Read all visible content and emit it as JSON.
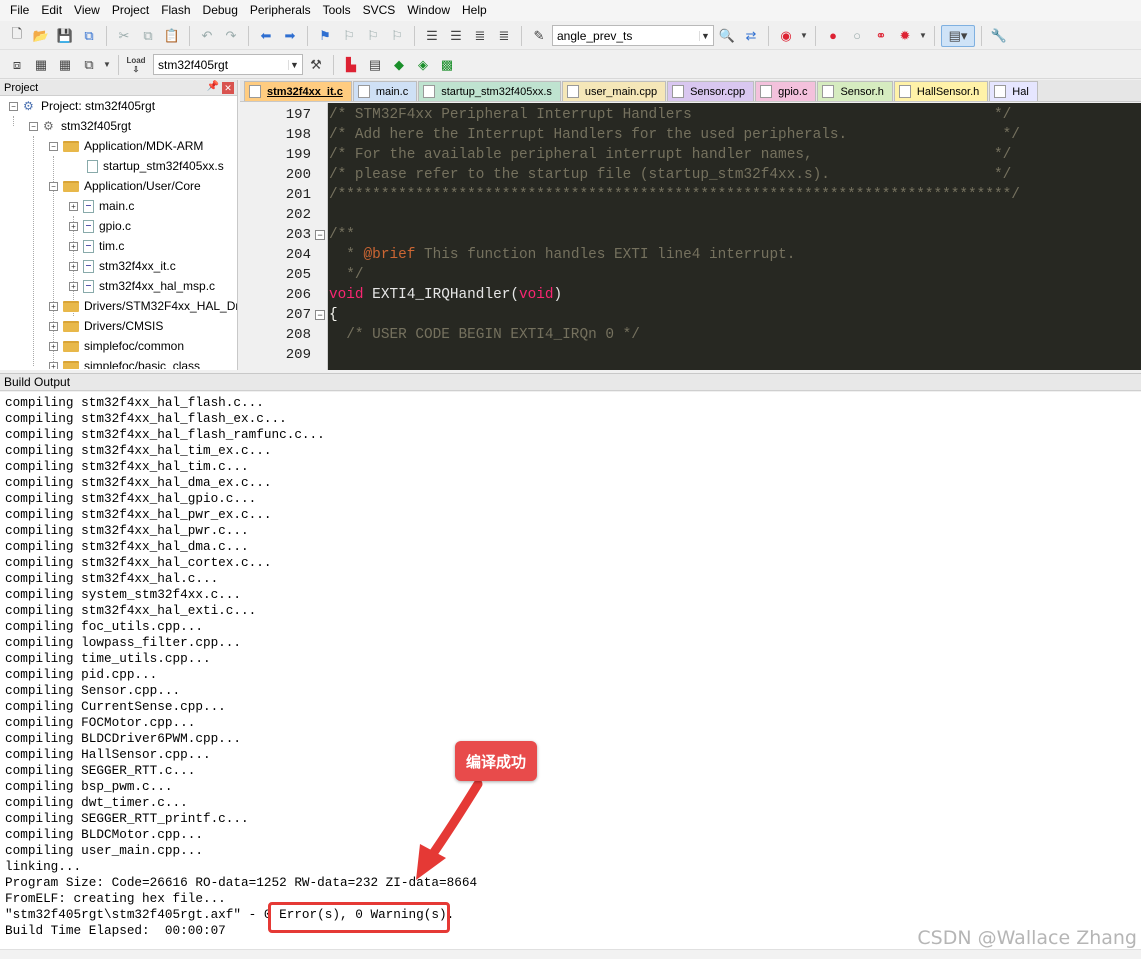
{
  "menu": [
    "File",
    "Edit",
    "View",
    "Project",
    "Flash",
    "Debug",
    "Peripherals",
    "Tools",
    "SVCS",
    "Window",
    "Help"
  ],
  "toolbar": {
    "find_combo": "angle_prev_ts",
    "target_combo": "stm32f405rgt",
    "load_label": "Load"
  },
  "project_panel": {
    "title": "Project",
    "items": [
      {
        "label": "Project: stm32f405rgt",
        "type": "project"
      },
      {
        "label": "stm32f405rgt",
        "type": "target"
      },
      {
        "label": "Application/MDK-ARM",
        "type": "folder"
      },
      {
        "label": "startup_stm32f405xx.s",
        "type": "file"
      },
      {
        "label": "Application/User/Core",
        "type": "folder"
      },
      {
        "label": "main.c",
        "type": "file"
      },
      {
        "label": "gpio.c",
        "type": "file"
      },
      {
        "label": "tim.c",
        "type": "file"
      },
      {
        "label": "stm32f4xx_it.c",
        "type": "file"
      },
      {
        "label": "stm32f4xx_hal_msp.c",
        "type": "file"
      },
      {
        "label": "Drivers/STM32F4xx_HAL_Dri",
        "type": "folder"
      },
      {
        "label": "Drivers/CMSIS",
        "type": "folder"
      },
      {
        "label": "simplefoc/common",
        "type": "folder"
      },
      {
        "label": "simplefoc/basic_class",
        "type": "folder"
      }
    ]
  },
  "tabs": [
    {
      "label": "stm32f4xx_it.c",
      "color": "#ffcc80",
      "active": true
    },
    {
      "label": "main.c",
      "color": "#cfe0f5",
      "active": false
    },
    {
      "label": "startup_stm32f405xx.s",
      "color": "#bfe3d0",
      "active": false
    },
    {
      "label": "user_main.cpp",
      "color": "#f5e7b8",
      "active": false
    },
    {
      "label": "Sensor.cpp",
      "color": "#d9c7f0",
      "active": false
    },
    {
      "label": "gpio.c",
      "color": "#f3c1dc",
      "active": false
    },
    {
      "label": "Sensor.h",
      "color": "#d6ecc0",
      "active": false
    },
    {
      "label": "HallSensor.h",
      "color": "#fff2a8",
      "active": false
    },
    {
      "label": "Hal",
      "color": "#e6e6ff",
      "active": false
    }
  ],
  "editor": {
    "line_numbers": [
      "197",
      "198",
      "199",
      "200",
      "201",
      "202",
      "203",
      "204",
      "205",
      "206",
      "207",
      "208",
      "209"
    ],
    "lines": [
      "/* STM32F4xx Peripheral Interrupt Handlers                                   */",
      "/* Add here the Interrupt Handlers for the used peripherals.                  */",
      "/* For the available peripheral interrupt handler names,                     */",
      "/* please refer to the startup file (startup_stm32f4xx.s).                   */",
      "/******************************************************************************/",
      "",
      "/**",
      "  * @brief This function handles EXTI line4 interrupt.",
      "  */",
      "void EXTI4_IRQHandler(void)",
      "{",
      "  /* USER CODE BEGIN EXTI4_IRQn 0 */",
      ""
    ],
    "brief_tag": "@brief",
    "brief_text": " This function handles EXTI line4 interrupt.",
    "kw_void": "void",
    "fn_name": " EXTI4_IRQHandler(",
    "fn_close": ")"
  },
  "build_output": {
    "title": "Build Output",
    "lines": [
      "compiling stm32f4xx_hal_flash.c...",
      "compiling stm32f4xx_hal_flash_ex.c...",
      "compiling stm32f4xx_hal_flash_ramfunc.c...",
      "compiling stm32f4xx_hal_tim_ex.c...",
      "compiling stm32f4xx_hal_tim.c...",
      "compiling stm32f4xx_hal_dma_ex.c...",
      "compiling stm32f4xx_hal_gpio.c...",
      "compiling stm32f4xx_hal_pwr_ex.c...",
      "compiling stm32f4xx_hal_pwr.c...",
      "compiling stm32f4xx_hal_dma.c...",
      "compiling stm32f4xx_hal_cortex.c...",
      "compiling stm32f4xx_hal.c...",
      "compiling system_stm32f4xx.c...",
      "compiling stm32f4xx_hal_exti.c...",
      "compiling foc_utils.cpp...",
      "compiling lowpass_filter.cpp...",
      "compiling time_utils.cpp...",
      "compiling pid.cpp...",
      "compiling Sensor.cpp...",
      "compiling CurrentSense.cpp...",
      "compiling FOCMotor.cpp...",
      "compiling BLDCDriver6PWM.cpp...",
      "compiling HallSensor.cpp...",
      "compiling SEGGER_RTT.c...",
      "compiling bsp_pwm.c...",
      "compiling dwt_timer.c...",
      "compiling SEGGER_RTT_printf.c...",
      "compiling BLDCMotor.cpp...",
      "compiling user_main.cpp...",
      "linking...",
      "Program Size: Code=26616 RO-data=1252 RW-data=232 ZI-data=8664",
      "FromELF: creating hex file...",
      "\"stm32f405rgt\\stm32f405rgt.axf\" - 0 Error(s), 0 Warning(s).",
      "Build Time Elapsed:  00:00:07"
    ]
  },
  "annotation": {
    "label": "编译成功",
    "color": "#e53935"
  },
  "watermark": "CSDN @Wallace Zhang"
}
